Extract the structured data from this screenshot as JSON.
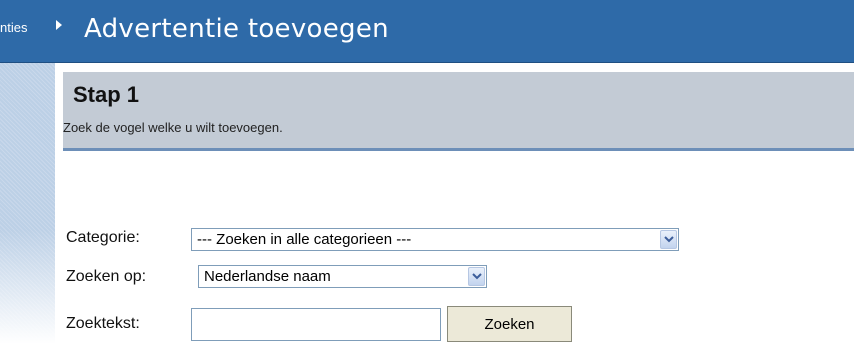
{
  "header": {
    "breadcrumb_prev": "nties",
    "title": "Advertentie toevoegen"
  },
  "step": {
    "title": "Stap 1",
    "description": "Zoek de vogel welke u wilt toevoegen."
  },
  "form": {
    "category": {
      "label": "Categorie:",
      "selected": "--- Zoeken in alle categorieen ---"
    },
    "search_on": {
      "label": "Zoeken op:",
      "selected": "Nederlandse naam"
    },
    "search_text": {
      "label": "Zoektekst:",
      "value": ""
    },
    "search_button": "Zoeken"
  }
}
